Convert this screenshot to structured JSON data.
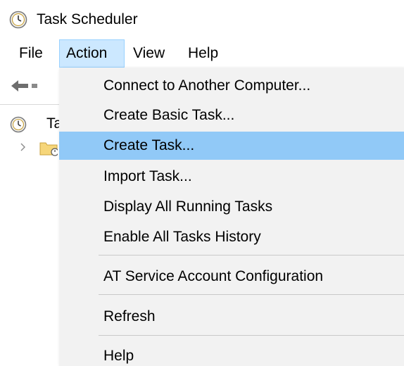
{
  "window": {
    "title": "Task Scheduler",
    "icon": "clock-icon"
  },
  "menubar": {
    "items": [
      {
        "label": "File"
      },
      {
        "label": "Action",
        "active": true
      },
      {
        "label": "View"
      },
      {
        "label": "Help"
      }
    ]
  },
  "toolbar": {
    "back_icon": "back-arrow-icon"
  },
  "tree": {
    "root_label": "Ta",
    "root_icon": "clock-icon",
    "child_icon": "folder-clock-icon",
    "expander_icon": "chevron-right-icon"
  },
  "action_menu": {
    "items": [
      {
        "label": "Connect to Another Computer..."
      },
      {
        "label": "Create Basic Task..."
      },
      {
        "label": "Create Task...",
        "highlighted": true
      },
      {
        "label": "Import Task..."
      },
      {
        "label": "Display All Running Tasks"
      },
      {
        "label": "Enable All Tasks History"
      },
      {
        "label": "AT Service Account Configuration"
      },
      {
        "label": "Refresh"
      },
      {
        "label": "Help"
      }
    ]
  },
  "colors": {
    "menu_background": "#f2f2f2",
    "highlight": "#91c9f7",
    "active_menu": "#cce8ff",
    "separator": "#c9c9c9"
  }
}
